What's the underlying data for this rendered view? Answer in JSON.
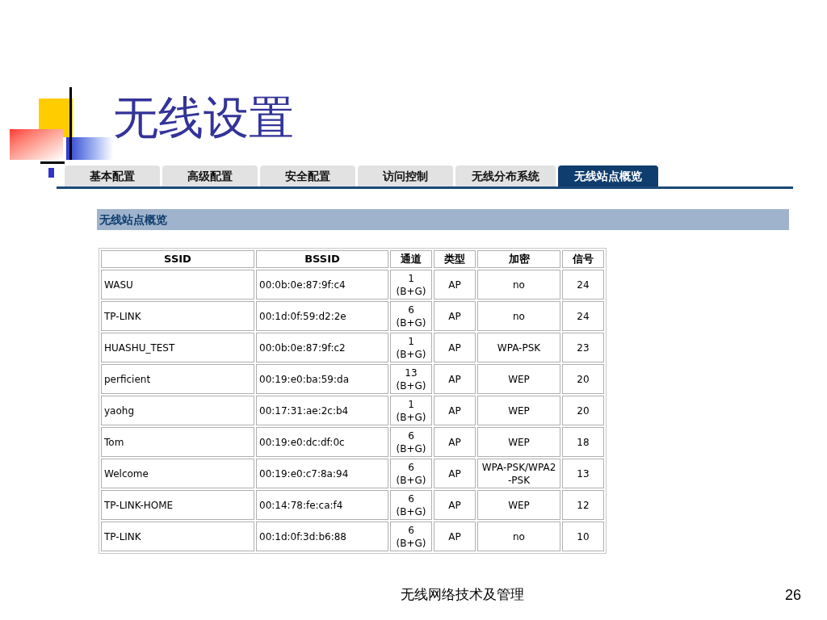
{
  "slide": {
    "title": "无线设置",
    "footer": "无线网络技术及管理",
    "page_number": "26"
  },
  "tabs": [
    {
      "label": "基本配置",
      "selected": false
    },
    {
      "label": "高级配置",
      "selected": false
    },
    {
      "label": "安全配置",
      "selected": false
    },
    {
      "label": "访问控制",
      "selected": false
    },
    {
      "label": "无线分布系统",
      "selected": false
    },
    {
      "label": "无线站点概览",
      "selected": true
    }
  ],
  "section_title": "无线站点概览",
  "table": {
    "columns": [
      "SSID",
      "BSSID",
      "通道",
      "类型",
      "加密",
      "信号"
    ],
    "rows": [
      [
        "WASU",
        "00:0b:0e:87:9f:c4",
        "1 (B+G)",
        "AP",
        "no",
        "24"
      ],
      [
        "TP-LINK",
        "00:1d:0f:59:d2:2e",
        "6 (B+G)",
        "AP",
        "no",
        "24"
      ],
      [
        "HUASHU_TEST",
        "00:0b:0e:87:9f:c2",
        "1 (B+G)",
        "AP",
        "WPA-PSK",
        "23"
      ],
      [
        "perficient",
        "00:19:e0:ba:59:da",
        "13 (B+G)",
        "AP",
        "WEP",
        "20"
      ],
      [
        "yaohg",
        "00:17:31:ae:2c:b4",
        "1 (B+G)",
        "AP",
        "WEP",
        "20"
      ],
      [
        "Tom",
        "00:19:e0:dc:df:0c",
        "6 (B+G)",
        "AP",
        "WEP",
        "18"
      ],
      [
        "Welcome",
        "00:19:e0:c7:8a:94",
        "6 (B+G)",
        "AP",
        "WPA-PSK/WPA2-PSK",
        "13"
      ],
      [
        "TP-LINK-HOME",
        "00:14:78:fe:ca:f4",
        "6 (B+G)",
        "AP",
        "WEP",
        "12"
      ],
      [
        "TP-LINK",
        "00:1d:0f:3d:b6:88",
        "6 (B+G)",
        "AP",
        "no",
        "10"
      ]
    ]
  }
}
